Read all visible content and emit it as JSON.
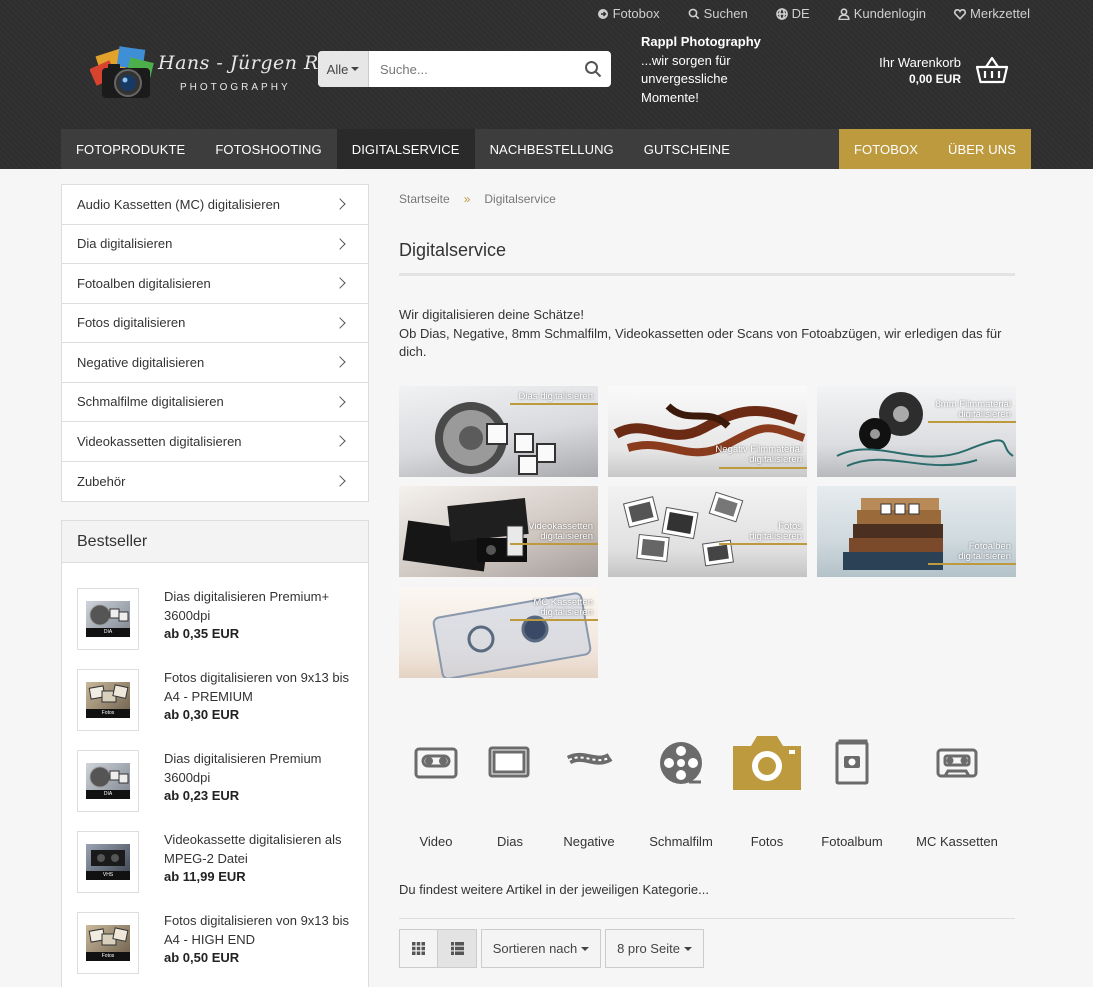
{
  "topbar": {
    "fotobox": "Fotobox",
    "search": "Suchen",
    "language": "DE",
    "login": "Kundenlogin",
    "wishlist": "Merkzettel"
  },
  "logo": {
    "line1": "Hans - Jürgen Rappl",
    "line2": "PHOTOGRAPHY"
  },
  "search": {
    "category": "Alle",
    "placeholder": "Suche..."
  },
  "slogan": {
    "title": "Rappl Photography",
    "line1": "...wir sorgen für",
    "line2": "unvergessliche",
    "line3": "Momente!"
  },
  "cart": {
    "label": "Ihr Warenkorb",
    "total": "0,00 EUR"
  },
  "nav": {
    "items": [
      "FOTOPRODUKTE",
      "FOTOSHOOTING",
      "DIGITALSERVICE",
      "NACHBESTELLUNG",
      "GUTSCHEINE"
    ],
    "right": [
      "FOTOBOX",
      "ÜBER UNS"
    ]
  },
  "categories": [
    "Audio Kassetten (MC) digitalisieren",
    "Dia digitalisieren",
    "Fotoalben digitalisieren",
    "Fotos digitalisieren",
    "Negative digitalisieren",
    "Schmalfilme digitalisieren",
    "Videokassetten digitalisieren",
    "Zubehör"
  ],
  "bestseller": {
    "title": "Bestseller",
    "items": [
      {
        "name1": "Dias digitalisieren Premium+",
        "name2": "3600dpi",
        "price": "ab 0,35 EUR",
        "thumb": "DIA"
      },
      {
        "name1": "Fotos digitalisieren von 9x13 bis",
        "name2": "A4 - PREMIUM",
        "price": "ab 0,30 EUR",
        "thumb": "Fotos"
      },
      {
        "name1": "Dias digitalisieren Premium",
        "name2": "3600dpi",
        "price": "ab 0,23 EUR",
        "thumb": "DIA"
      },
      {
        "name1": "Videokassette digitalisieren als",
        "name2": "MPEG-2 Datei",
        "price": "ab 11,99 EUR",
        "thumb": "VHS"
      },
      {
        "name1": "Fotos digitalisieren von 9x13 bis",
        "name2": "A4 - HIGH END",
        "price": "ab 0,50 EUR",
        "thumb": "Fotos"
      }
    ]
  },
  "breadcrumb": {
    "home": "Startseite",
    "sep": "»",
    "current": "Digitalservice"
  },
  "page": {
    "title": "Digitalservice",
    "intro1": "Wir digitalisieren deine Schätze!",
    "intro2": "Ob Dias, Negative, 8mm Schmalfilm, Videokassetten oder Scans von Fotoabzügen, wir erledigen das für dich."
  },
  "tiles": [
    {
      "l1": "Dias digitalisieren",
      "l2": ""
    },
    {
      "l1": "Negativ Filmmaterial",
      "l2": "digitalisieren"
    },
    {
      "l1": "8mm Filmmaterial",
      "l2": "digitalisieren"
    },
    {
      "l1": "Videokassetten",
      "l2": "digitalisieren"
    },
    {
      "l1": "Fotos",
      "l2": "digitalisieren"
    },
    {
      "l1": "Fotoalben",
      "l2": "digitalisieren"
    },
    {
      "l1": "MC Kassetten",
      "l2": "digitalisieren"
    }
  ],
  "iconcats": [
    "Video",
    "Dias",
    "Negative",
    "Schmalfilm",
    "Fotos",
    "Fotoalbum",
    "MC Kassetten"
  ],
  "more_text": "Du findest weitere Artikel in der jeweiligen Kategorie...",
  "toolbar": {
    "sort": "Sortieren nach",
    "perpage": "8 pro Seite"
  },
  "colors": {
    "gold": "#bd9a3e",
    "header": "#2f2f2f",
    "nav": "#3d3d3d"
  }
}
